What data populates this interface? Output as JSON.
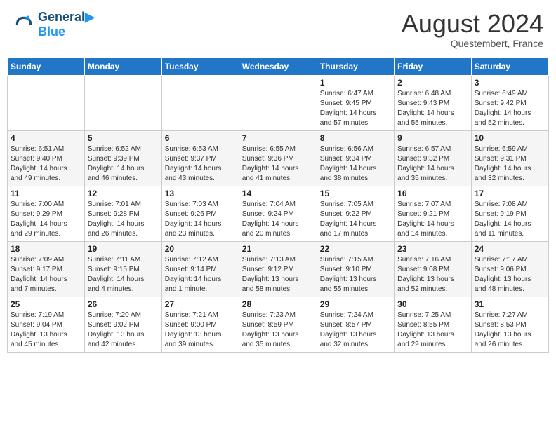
{
  "header": {
    "logo_line1": "General",
    "logo_line2": "Blue",
    "month_year": "August 2024",
    "location": "Questembert, France"
  },
  "weekdays": [
    "Sunday",
    "Monday",
    "Tuesday",
    "Wednesday",
    "Thursday",
    "Friday",
    "Saturday"
  ],
  "weeks": [
    [
      {
        "day": "",
        "info": ""
      },
      {
        "day": "",
        "info": ""
      },
      {
        "day": "",
        "info": ""
      },
      {
        "day": "",
        "info": ""
      },
      {
        "day": "1",
        "info": "Sunrise: 6:47 AM\nSunset: 9:45 PM\nDaylight: 14 hours\nand 57 minutes."
      },
      {
        "day": "2",
        "info": "Sunrise: 6:48 AM\nSunset: 9:43 PM\nDaylight: 14 hours\nand 55 minutes."
      },
      {
        "day": "3",
        "info": "Sunrise: 6:49 AM\nSunset: 9:42 PM\nDaylight: 14 hours\nand 52 minutes."
      }
    ],
    [
      {
        "day": "4",
        "info": "Sunrise: 6:51 AM\nSunset: 9:40 PM\nDaylight: 14 hours\nand 49 minutes."
      },
      {
        "day": "5",
        "info": "Sunrise: 6:52 AM\nSunset: 9:39 PM\nDaylight: 14 hours\nand 46 minutes."
      },
      {
        "day": "6",
        "info": "Sunrise: 6:53 AM\nSunset: 9:37 PM\nDaylight: 14 hours\nand 43 minutes."
      },
      {
        "day": "7",
        "info": "Sunrise: 6:55 AM\nSunset: 9:36 PM\nDaylight: 14 hours\nand 41 minutes."
      },
      {
        "day": "8",
        "info": "Sunrise: 6:56 AM\nSunset: 9:34 PM\nDaylight: 14 hours\nand 38 minutes."
      },
      {
        "day": "9",
        "info": "Sunrise: 6:57 AM\nSunset: 9:32 PM\nDaylight: 14 hours\nand 35 minutes."
      },
      {
        "day": "10",
        "info": "Sunrise: 6:59 AM\nSunset: 9:31 PM\nDaylight: 14 hours\nand 32 minutes."
      }
    ],
    [
      {
        "day": "11",
        "info": "Sunrise: 7:00 AM\nSunset: 9:29 PM\nDaylight: 14 hours\nand 29 minutes."
      },
      {
        "day": "12",
        "info": "Sunrise: 7:01 AM\nSunset: 9:28 PM\nDaylight: 14 hours\nand 26 minutes."
      },
      {
        "day": "13",
        "info": "Sunrise: 7:03 AM\nSunset: 9:26 PM\nDaylight: 14 hours\nand 23 minutes."
      },
      {
        "day": "14",
        "info": "Sunrise: 7:04 AM\nSunset: 9:24 PM\nDaylight: 14 hours\nand 20 minutes."
      },
      {
        "day": "15",
        "info": "Sunrise: 7:05 AM\nSunset: 9:22 PM\nDaylight: 14 hours\nand 17 minutes."
      },
      {
        "day": "16",
        "info": "Sunrise: 7:07 AM\nSunset: 9:21 PM\nDaylight: 14 hours\nand 14 minutes."
      },
      {
        "day": "17",
        "info": "Sunrise: 7:08 AM\nSunset: 9:19 PM\nDaylight: 14 hours\nand 11 minutes."
      }
    ],
    [
      {
        "day": "18",
        "info": "Sunrise: 7:09 AM\nSunset: 9:17 PM\nDaylight: 14 hours\nand 7 minutes."
      },
      {
        "day": "19",
        "info": "Sunrise: 7:11 AM\nSunset: 9:15 PM\nDaylight: 14 hours\nand 4 minutes."
      },
      {
        "day": "20",
        "info": "Sunrise: 7:12 AM\nSunset: 9:14 PM\nDaylight: 14 hours\nand 1 minute."
      },
      {
        "day": "21",
        "info": "Sunrise: 7:13 AM\nSunset: 9:12 PM\nDaylight: 13 hours\nand 58 minutes."
      },
      {
        "day": "22",
        "info": "Sunrise: 7:15 AM\nSunset: 9:10 PM\nDaylight: 13 hours\nand 55 minutes."
      },
      {
        "day": "23",
        "info": "Sunrise: 7:16 AM\nSunset: 9:08 PM\nDaylight: 13 hours\nand 52 minutes."
      },
      {
        "day": "24",
        "info": "Sunrise: 7:17 AM\nSunset: 9:06 PM\nDaylight: 13 hours\nand 48 minutes."
      }
    ],
    [
      {
        "day": "25",
        "info": "Sunrise: 7:19 AM\nSunset: 9:04 PM\nDaylight: 13 hours\nand 45 minutes."
      },
      {
        "day": "26",
        "info": "Sunrise: 7:20 AM\nSunset: 9:02 PM\nDaylight: 13 hours\nand 42 minutes."
      },
      {
        "day": "27",
        "info": "Sunrise: 7:21 AM\nSunset: 9:00 PM\nDaylight: 13 hours\nand 39 minutes."
      },
      {
        "day": "28",
        "info": "Sunrise: 7:23 AM\nSunset: 8:59 PM\nDaylight: 13 hours\nand 35 minutes."
      },
      {
        "day": "29",
        "info": "Sunrise: 7:24 AM\nSunset: 8:57 PM\nDaylight: 13 hours\nand 32 minutes."
      },
      {
        "day": "30",
        "info": "Sunrise: 7:25 AM\nSunset: 8:55 PM\nDaylight: 13 hours\nand 29 minutes."
      },
      {
        "day": "31",
        "info": "Sunrise: 7:27 AM\nSunset: 8:53 PM\nDaylight: 13 hours\nand 26 minutes."
      }
    ]
  ]
}
